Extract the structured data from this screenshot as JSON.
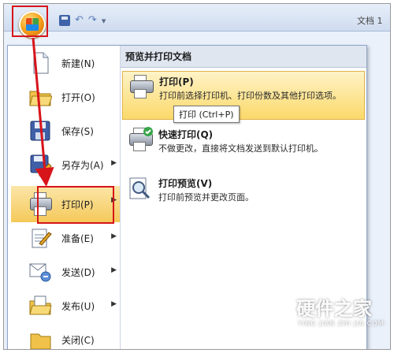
{
  "window": {
    "title": "文档 1"
  },
  "quick_access": {
    "undo_glyph": "↶",
    "redo_glyph": "↷",
    "customize_glyph": "▾"
  },
  "menu": {
    "left_items": [
      {
        "id": "new",
        "label": "新建(N)",
        "icon": "new-document-icon",
        "has_submenu": false
      },
      {
        "id": "open",
        "label": "打开(O)",
        "icon": "open-folder-icon",
        "has_submenu": false
      },
      {
        "id": "save",
        "label": "保存(S)",
        "icon": "save-icon",
        "has_submenu": false
      },
      {
        "id": "save-as",
        "label": "另存为(A)",
        "icon": "save-as-icon",
        "has_submenu": true
      },
      {
        "id": "print",
        "label": "打印(P)",
        "icon": "printer-icon",
        "has_submenu": true,
        "active": true
      },
      {
        "id": "prepare",
        "label": "准备(E)",
        "icon": "prepare-icon",
        "has_submenu": true
      },
      {
        "id": "send",
        "label": "发送(D)",
        "icon": "send-icon",
        "has_submenu": true
      },
      {
        "id": "publish",
        "label": "发布(U)",
        "icon": "publish-icon",
        "has_submenu": true
      },
      {
        "id": "close",
        "label": "关闭(C)",
        "icon": "close-folder-icon",
        "has_submenu": false
      }
    ],
    "submenu_arrow": "▶",
    "right_header": "预览并打印文档",
    "right_items": [
      {
        "id": "print",
        "title": "打印(P)",
        "desc": "打印前选择打印机、打印份数及其他打印选项。",
        "icon": "printer-icon",
        "active": true
      },
      {
        "id": "quick-print",
        "title": "快速打印(Q)",
        "desc": "不做更改，直接将文档发送到默认打印机。",
        "icon": "quick-print-icon"
      },
      {
        "id": "print-preview",
        "title": "打印预览(V)",
        "desc": "打印前预览并更改页面。",
        "icon": "print-preview-icon"
      }
    ],
    "tooltip": "打印 (Ctrl+P)"
  },
  "watermark": {
    "title": "硬件之家",
    "subtitle": "YING JIAN ZHI JIA.COM"
  },
  "colors": {
    "highlight_red": "#d7141a",
    "active_gold": "#f5c95a"
  }
}
